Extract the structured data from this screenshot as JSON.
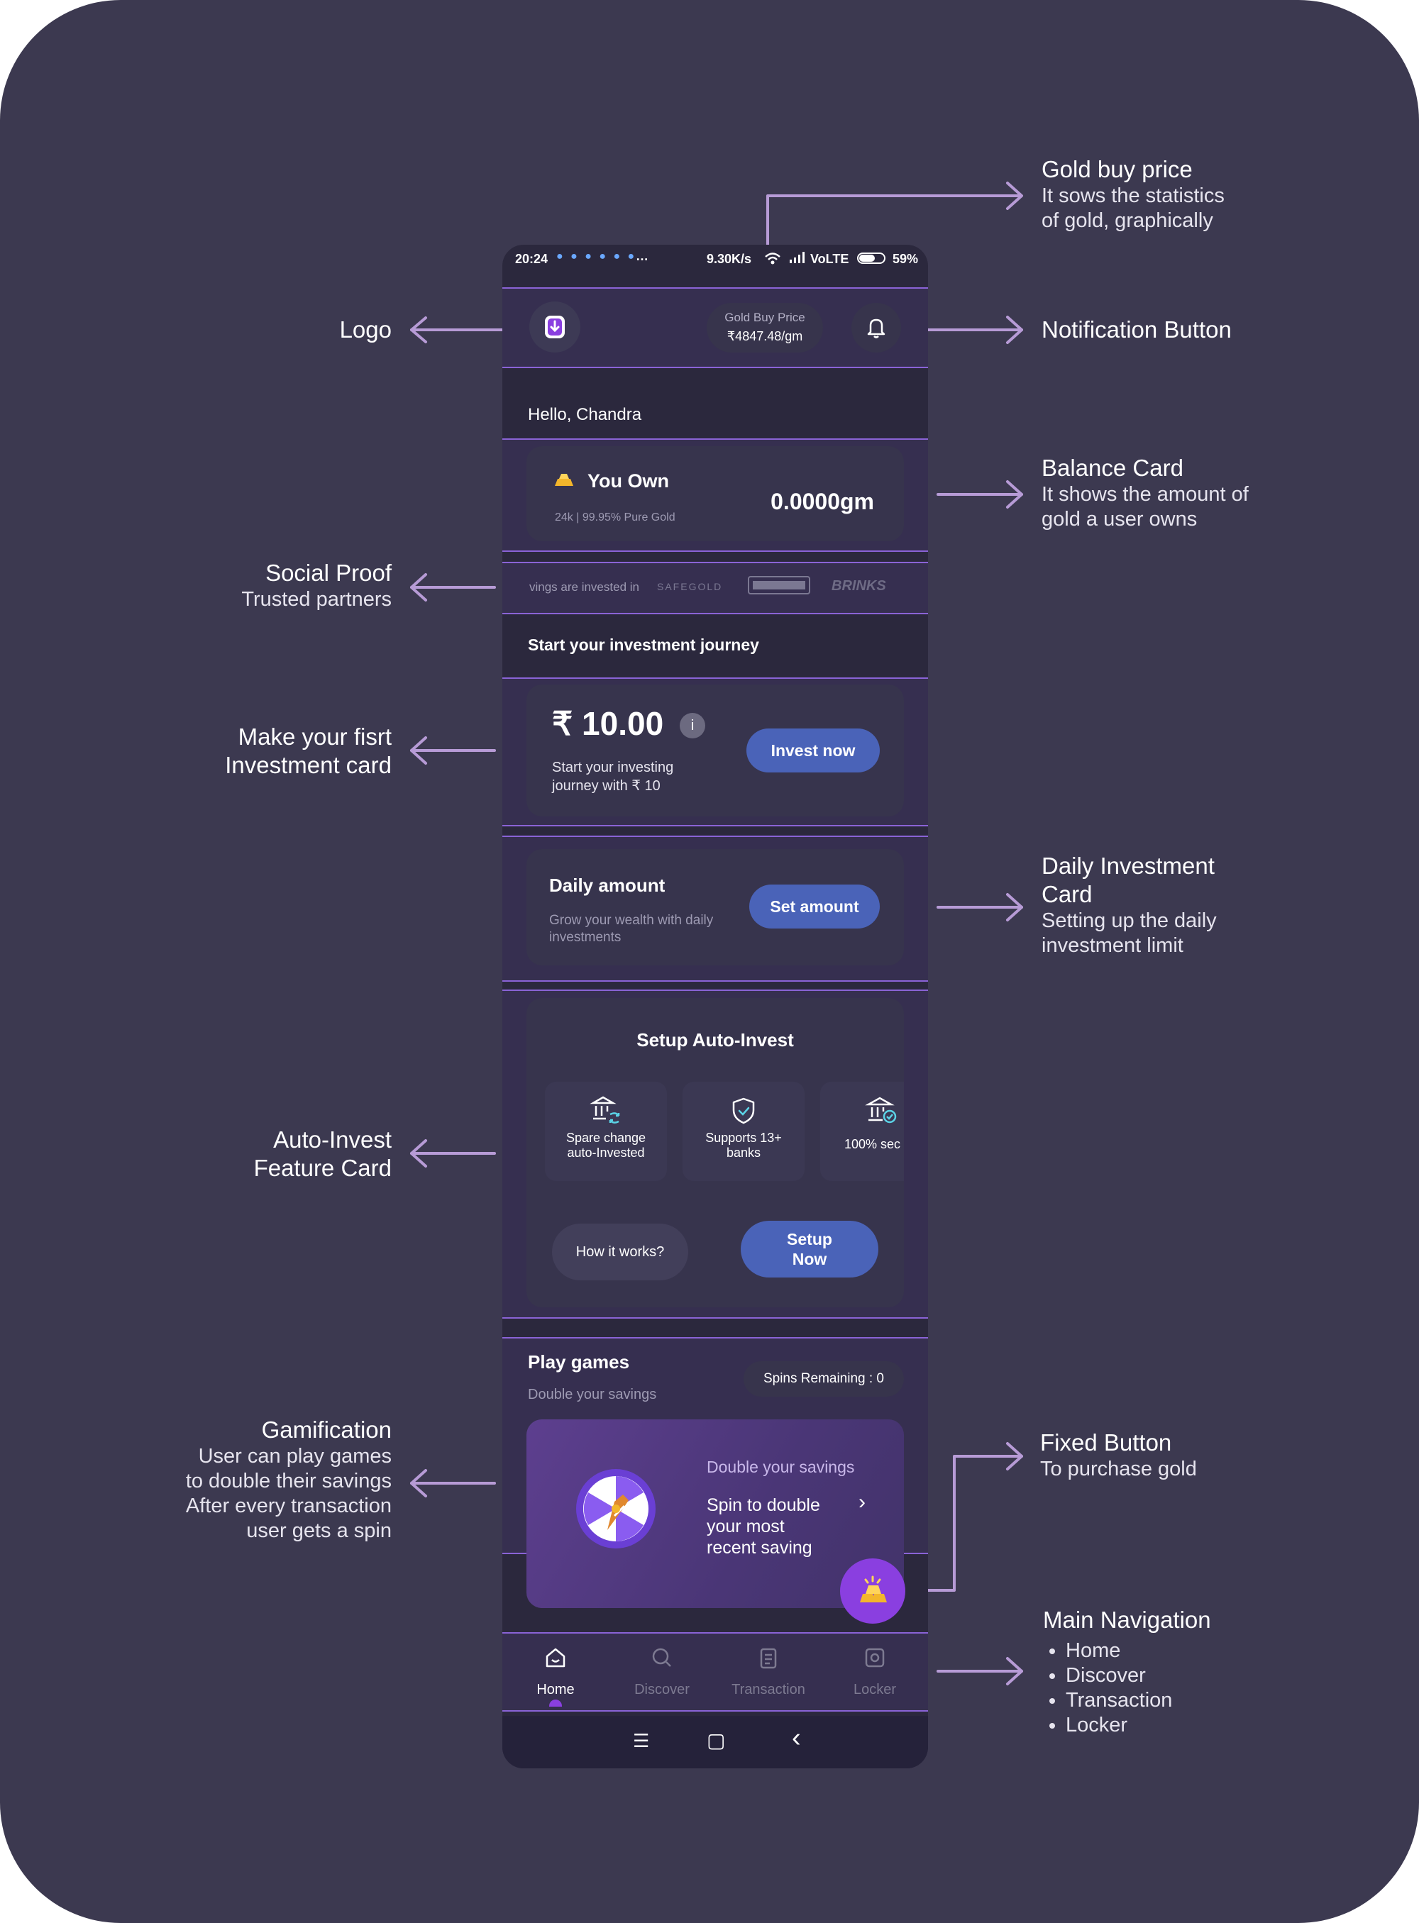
{
  "annotations": {
    "logo": {
      "title": "Logo"
    },
    "gold_buy_price": {
      "title": "Gold buy price",
      "desc_1": "It sows the statistics",
      "desc_2": "of gold, graphically"
    },
    "notification": {
      "title": "Notification Button"
    },
    "balance": {
      "title": "Balance Card",
      "desc_1": "It shows the amount of",
      "desc_2": "gold a user owns"
    },
    "social": {
      "title": "Social Proof",
      "desc_1": "Trusted partners"
    },
    "first_invest": {
      "title_1": "Make your fisrt",
      "title_2": "Investment card"
    },
    "daily": {
      "title_1": "Daily Investment",
      "title_2": "Card",
      "desc_1": "Setting up the daily",
      "desc_2": "investment limit"
    },
    "auto": {
      "title_1": "Auto-Invest",
      "title_2": "Feature Card"
    },
    "gamification": {
      "title": "Gamification",
      "desc_1": "User can play games",
      "desc_2": "to double their savings",
      "desc_3": "After every transaction",
      "desc_4": "user gets a spin"
    },
    "fixed": {
      "title": "Fixed Button",
      "desc_1": "To purchase gold"
    },
    "nav": {
      "title": "Main Navigation",
      "items": [
        "Home",
        "Discover",
        "Transaction",
        "Locker"
      ]
    }
  },
  "status_bar": {
    "time": "20:24",
    "speed": "9.30K/s",
    "network": "VoLTE",
    "battery": "59%"
  },
  "header": {
    "gold_price_label": "Gold Buy Price",
    "gold_price_value": "₹4847.48/gm"
  },
  "greeting": "Hello, Chandra",
  "balance_card": {
    "label": "You Own",
    "sub": "24k | 99.95% Pure Gold",
    "amount": "0.0000gm"
  },
  "partners": {
    "text": "vings are invested in",
    "logos": [
      "SAFEGOLD",
      "BRINKS"
    ]
  },
  "journey_title": "Start your investment journey",
  "invest_card": {
    "amount": "₹ 10.00",
    "info": "i",
    "sub_1": "Start your investing",
    "sub_2": "journey with ₹ 10",
    "button": "Invest now"
  },
  "daily_card": {
    "title": "Daily amount",
    "sub_1": "Grow your wealth with daily",
    "sub_2": "investments",
    "button": "Set amount"
  },
  "auto_card": {
    "title": "Setup Auto-Invest",
    "features": [
      {
        "line1": "Spare change",
        "line2": "auto-Invested"
      },
      {
        "line1": "Supports 13+",
        "line2": "banks"
      },
      {
        "line1": "100% sec",
        "line2": ""
      }
    ],
    "how_button": "How it works?",
    "setup_1": "Setup",
    "setup_2": "Now"
  },
  "games": {
    "title": "Play games",
    "sub": "Double your savings",
    "spins": "Spins Remaining : 0",
    "banner_sub": "Double your savings",
    "banner_1": "Spin to double",
    "banner_2": "your most",
    "banner_3": "recent saving",
    "chevron": "›"
  },
  "bottom_nav": {
    "items": [
      "Home",
      "Discover",
      "Transaction",
      "Locker"
    ],
    "active": "Home"
  },
  "system_nav": {
    "menu": "☰",
    "home": "▢",
    "back": "‹"
  },
  "colors": {
    "background": "#3c3950",
    "phone": "#2b283d",
    "card": "#37344d",
    "accent_button": "#4a63b8",
    "highlight": "#8a63d6",
    "fab": "#8a3fe0"
  }
}
